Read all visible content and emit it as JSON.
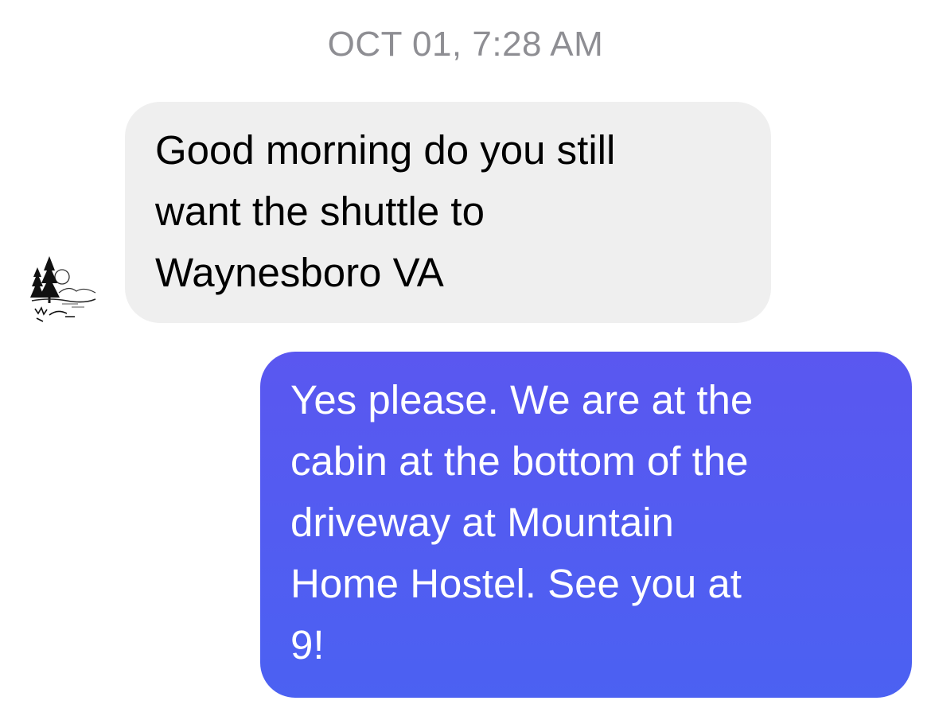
{
  "conversation": {
    "timestamp": "OCT 01, 7:28 AM",
    "messages": [
      {
        "direction": "incoming",
        "text": "Good morning do you still\nwant the shuttle to\nWaynesboro VA",
        "sender_avatar_icon": "landscape-trees-avatar-icon"
      },
      {
        "direction": "outgoing",
        "text": "Yes please. We are at the\ncabin at the bottom of the\ndriveway at Mountain\nHome Hostel. See you at\n9!"
      }
    ]
  },
  "colors": {
    "incoming_bubble": "#efefef",
    "outgoing_bubble_top": "#5a57f0",
    "outgoing_bubble_bottom": "#4b61f2",
    "timestamp_text": "#8e8e93"
  }
}
